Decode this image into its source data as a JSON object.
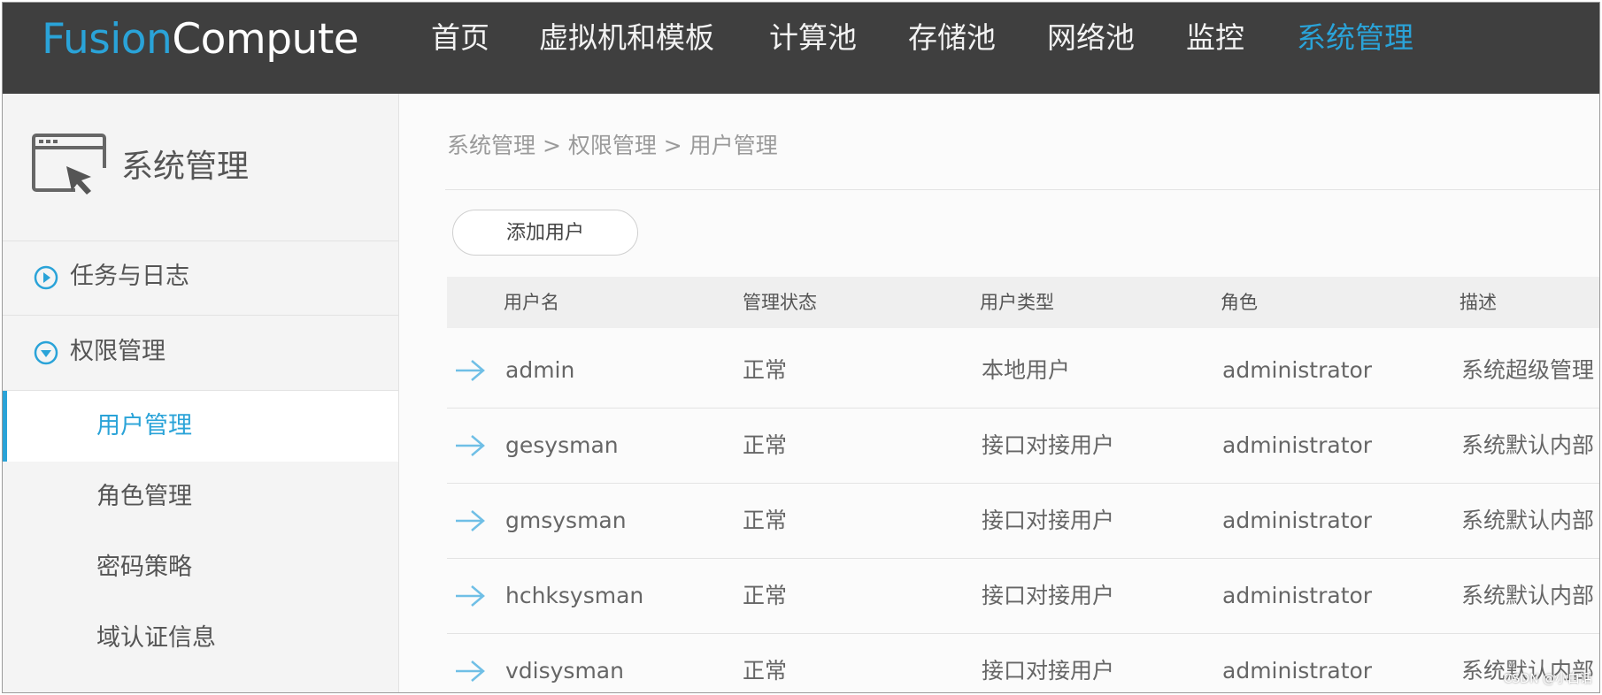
{
  "brand": {
    "part1": "Fusion",
    "part2": "Compute"
  },
  "nav": [
    {
      "label": "首页"
    },
    {
      "label": "虚拟机和模板"
    },
    {
      "label": "计算池"
    },
    {
      "label": "存储池"
    },
    {
      "label": "网络池"
    },
    {
      "label": "监控"
    },
    {
      "label": "系统管理",
      "active": true
    }
  ],
  "sidebar": {
    "title": "系统管理",
    "sections": [
      {
        "label": "任务与日志",
        "icon": "circle-play-icon"
      },
      {
        "label": "权限管理",
        "icon": "circle-expand-icon"
      }
    ],
    "items": [
      {
        "label": "用户管理",
        "active": true
      },
      {
        "label": "角色管理"
      },
      {
        "label": "密码策略"
      },
      {
        "label": "域认证信息"
      }
    ]
  },
  "breadcrumb": "系统管理 > 权限管理 > 用户管理",
  "add_button": "添加用户",
  "table": {
    "headers": [
      "用户名",
      "管理状态",
      "用户类型",
      "角色",
      "描述"
    ],
    "rows": [
      {
        "name": "admin",
        "status": "正常",
        "type": "本地用户",
        "role": "administrator",
        "desc": "系统超级管理员"
      },
      {
        "name": "gesysman",
        "status": "正常",
        "type": "接口对接用户",
        "role": "administrator",
        "desc": "系统默认内部"
      },
      {
        "name": "gmsysman",
        "status": "正常",
        "type": "接口对接用户",
        "role": "administrator",
        "desc": "系统默认内部"
      },
      {
        "name": "hchksysman",
        "status": "正常",
        "type": "接口对接用户",
        "role": "administrator",
        "desc": "系统默认内部"
      },
      {
        "name": "vdisysman",
        "status": "正常",
        "type": "接口对接用户",
        "role": "administrator",
        "desc": "系统默认内部"
      }
    ]
  },
  "watermark": "CSDN @小白话",
  "colors": {
    "accent": "#2aa3d8",
    "topbar": "#3f3f3f"
  }
}
